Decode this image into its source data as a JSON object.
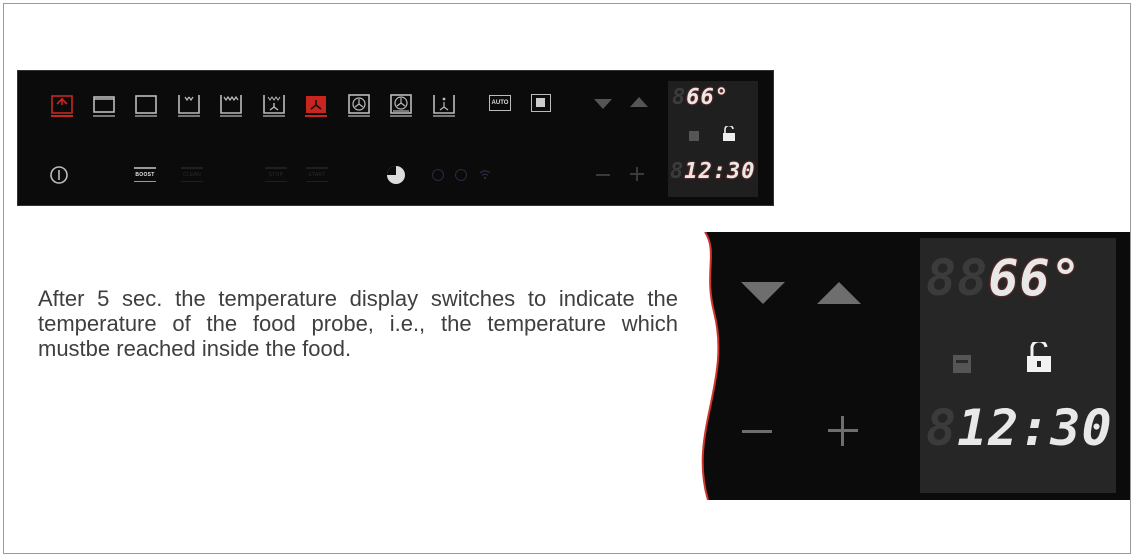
{
  "panel": {
    "buttons": {
      "boost": "BOOST",
      "clean": "CLEAN",
      "stop": "STOP",
      "start": "START",
      "auto": "AUTO"
    },
    "display": {
      "temp_ghost": "8",
      "temp_value": "66",
      "temp_unit": "°",
      "time_ghost": "8",
      "time_value": "12:30"
    }
  },
  "zoom": {
    "display": {
      "temp_ghost": "88",
      "temp_value": "66",
      "temp_unit": "°",
      "time_ghost": "8",
      "time_value": "12:30"
    }
  },
  "description": "After 5 sec. the temperature display switches to indicate the temperature of the food probe, i.e., the temperature which mustbe reached inside the food.",
  "colors": {
    "accent": "#c8251f",
    "panel_bg": "#0b0b0b",
    "display_bg": "#262626"
  }
}
